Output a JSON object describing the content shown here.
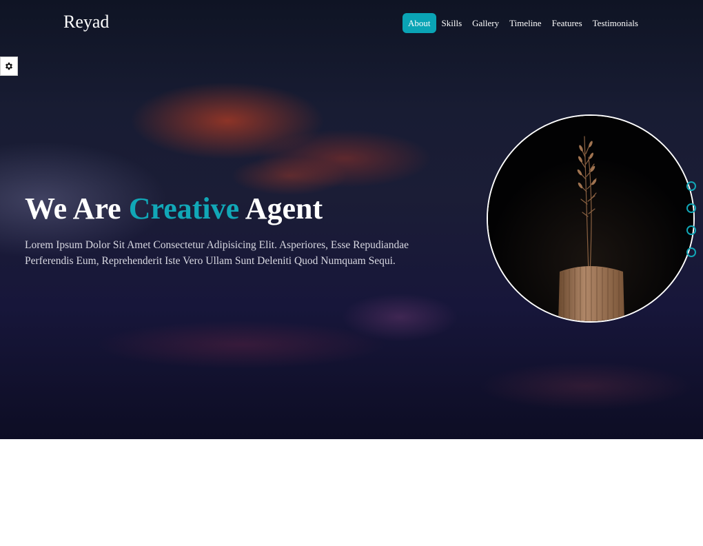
{
  "brand": {
    "name": "Reyad"
  },
  "nav": {
    "items": [
      {
        "label": "About",
        "active": true
      },
      {
        "label": "Skills"
      },
      {
        "label": "Gallery"
      },
      {
        "label": "Timeline"
      },
      {
        "label": "Features"
      },
      {
        "label": "Testimonials"
      }
    ]
  },
  "settings": {
    "icon": "gear-icon"
  },
  "hero": {
    "title_part1": "We Are ",
    "title_accent": "Creative",
    "title_part2": " Agent",
    "text": "Lorem Ipsum Dolor Sit Amet Consectetur Adipisicing Elit. Asperiores, Esse Repudiandae Perferendis Eum, Reprehenderit Iste Vero Ullam Sunt Deleniti Quod Numquam Sequi."
  },
  "colors": {
    "accent": "#11a7b7",
    "nav_active": "#0aa4b5"
  },
  "bullets": {
    "count": 4
  }
}
